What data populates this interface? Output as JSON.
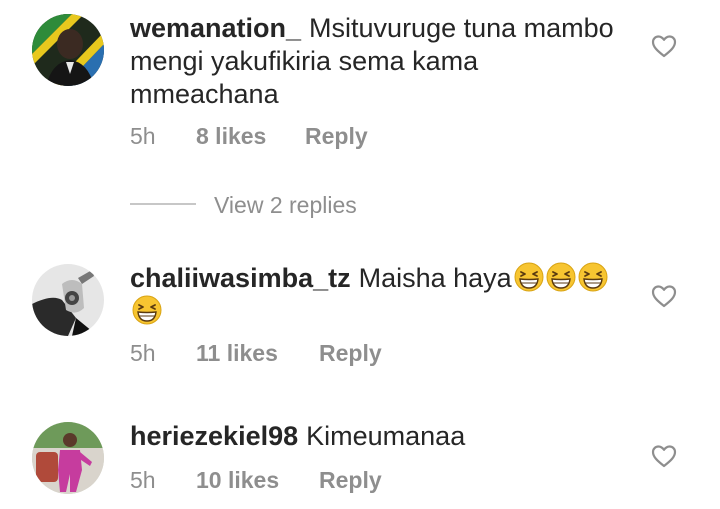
{
  "comments": [
    {
      "username": "wemanation_",
      "text": "Msituvuruge tuna mambo mengi yakufikiria sema kama mmeachana",
      "time": "5h",
      "likes": "8 likes",
      "reply": "Reply"
    },
    {
      "username": "chaliiwasimba_tz",
      "text": "Maisha haya",
      "emoji_count": 4,
      "time": "5h",
      "likes": "11 likes",
      "reply": "Reply"
    },
    {
      "username": "heriezekiel98",
      "text": "Kimeumanaa",
      "time": "5h",
      "likes": "10 likes",
      "reply": "Reply"
    }
  ],
  "view_replies": "View 2 replies",
  "icons": {
    "like": "heart-outline-icon",
    "emoji": "grinning-squinting-face-emoji"
  },
  "colors": {
    "text": "#262626",
    "meta": "#8e8e8e",
    "divider": "#c7c7c7"
  }
}
